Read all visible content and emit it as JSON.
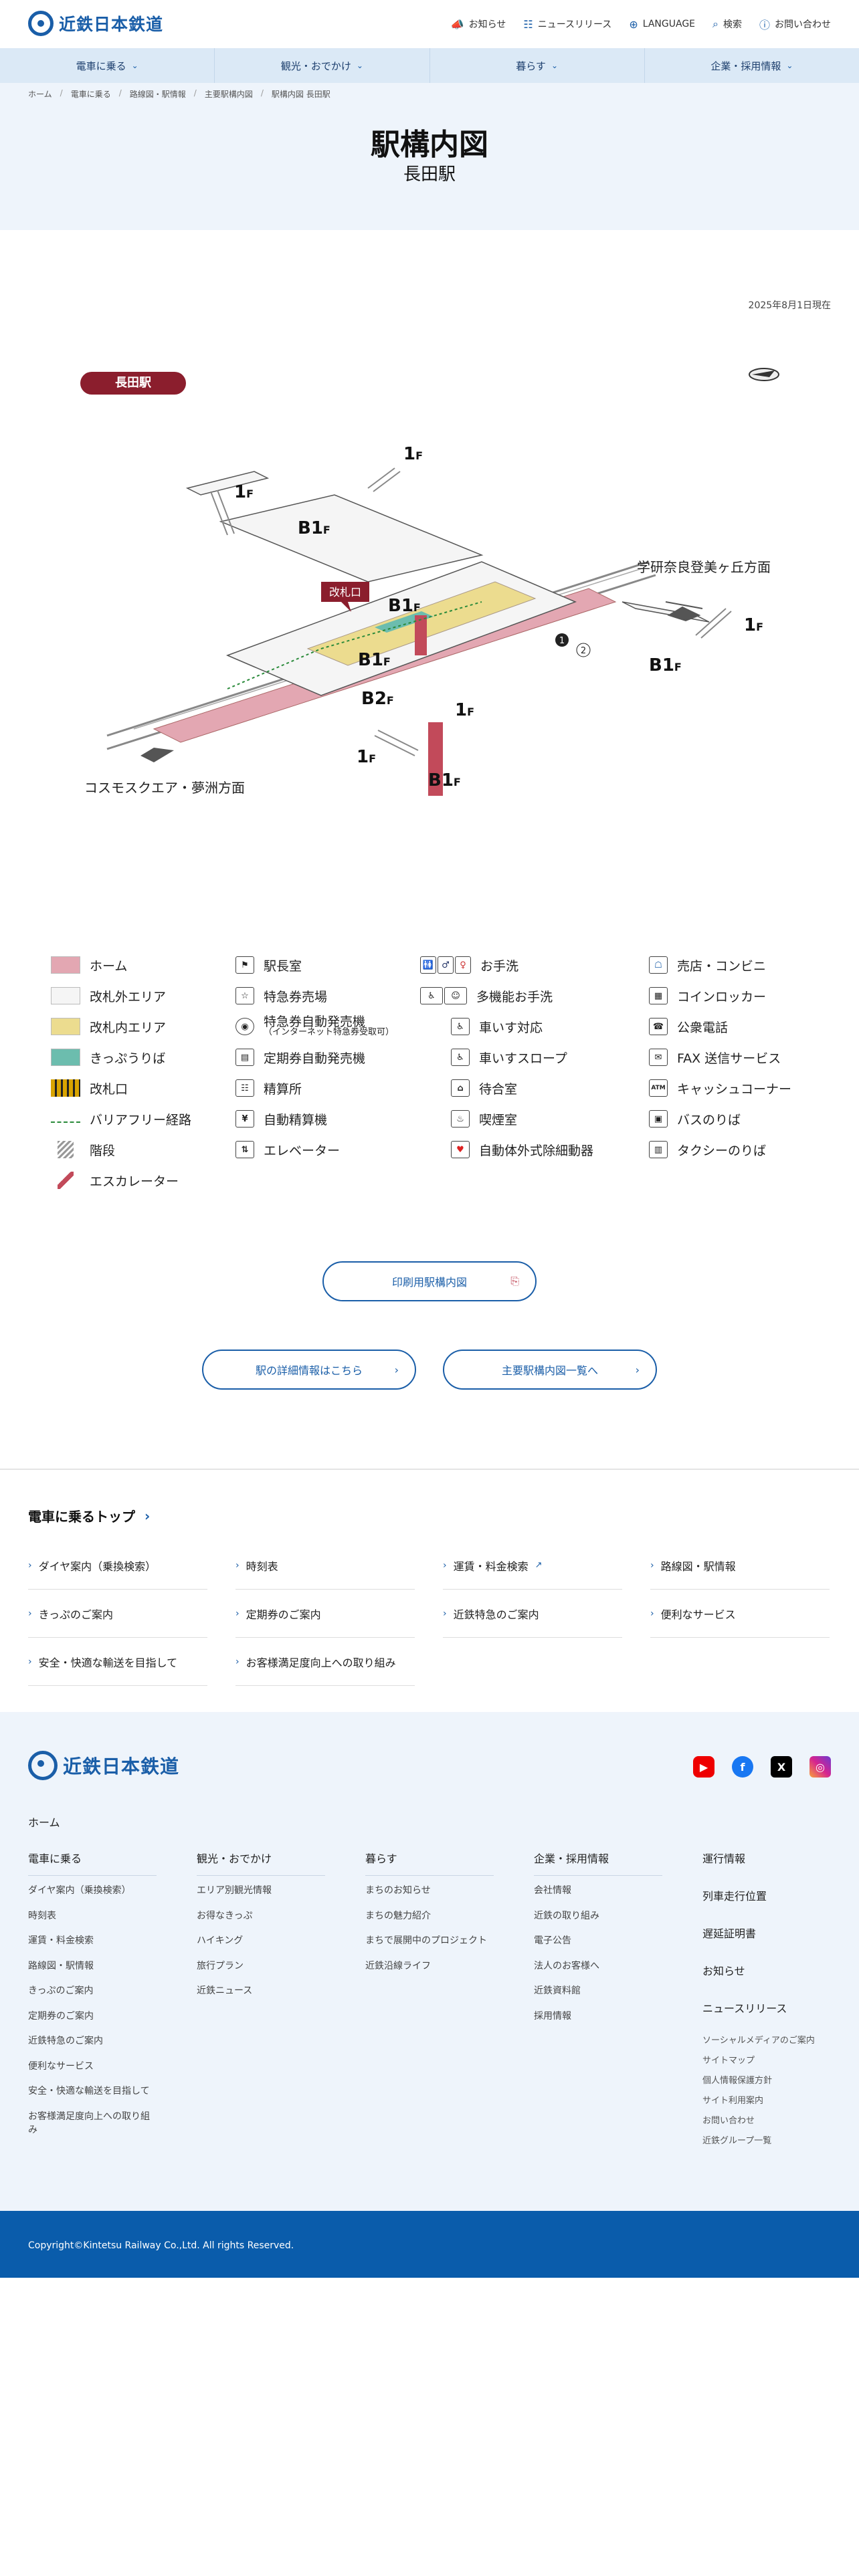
{
  "header": {
    "logo": "近鉄日本鉄道",
    "util_nav": [
      {
        "label": "お知らせ",
        "icon": "megaphone-icon"
      },
      {
        "label": "ニュースリリース",
        "icon": "document-icon"
      },
      {
        "label": "LANGUAGE",
        "icon": "globe-icon"
      },
      {
        "label": "検索",
        "icon": "search-icon"
      },
      {
        "label": "お問い合わせ",
        "icon": "question-icon"
      }
    ],
    "gnav": [
      "電車に乗る",
      "観光・おでかけ",
      "暮らす",
      "企業・採用情報"
    ]
  },
  "breadcrumb": [
    "ホーム",
    "電車に乗る",
    "路線図・駅情報",
    "主要駅構内図",
    "駅構内図 長田駅"
  ],
  "page": {
    "title": "駅構内図",
    "subtitle": "長田駅",
    "updated": "2025年8月1日現在"
  },
  "map": {
    "station_name": "長田駅",
    "direction_east": "学研奈良登美ヶ丘方面",
    "direction_west": "コスモスクエア・夢洲方面",
    "gate_label": "改札口",
    "floors": [
      "1F",
      "1F",
      "B1F",
      "B1F",
      "B1F",
      "B2F",
      "1F",
      "1F",
      "B1F",
      "1F",
      "B1F"
    ],
    "platforms": [
      "1",
      "2"
    ]
  },
  "legend": {
    "col1": [
      {
        "label": "ホーム",
        "color": "#e3a7b2"
      },
      {
        "label": "改札外エリア",
        "color": "#f5f5f5"
      },
      {
        "label": "改札内エリア",
        "color": "#ecdc8f"
      },
      {
        "label": "きっぷうりば",
        "color": "#6cbdae"
      },
      {
        "label": "改札口"
      },
      {
        "label": "バリアフリー経路"
      },
      {
        "label": "階段"
      },
      {
        "label": "エスカレーター"
      }
    ],
    "col2": [
      {
        "label": "駅長室",
        "sub": ""
      },
      {
        "label": "特急券売場",
        "sub": ""
      },
      {
        "label": "特急券自動発売機",
        "sub": "（インターネット特急券受取可）"
      },
      {
        "label": "定期券自動発売機",
        "sub": ""
      },
      {
        "label": "精算所",
        "sub": ""
      },
      {
        "label": "自動精算機",
        "sub": ""
      },
      {
        "label": "エレベーター",
        "sub": ""
      }
    ],
    "col3": [
      {
        "label": "お手洗"
      },
      {
        "label": "多機能お手洗"
      },
      {
        "label": "車いす対応"
      },
      {
        "label": "車いすスロープ"
      },
      {
        "label": "待合室"
      },
      {
        "label": "喫煙室"
      },
      {
        "label": "自動体外式除細動器"
      }
    ],
    "col4": [
      {
        "label": "売店・コンビニ"
      },
      {
        "label": "コインロッカー"
      },
      {
        "label": "公衆電話"
      },
      {
        "label": "FAX 送信サービス"
      },
      {
        "label": "キャッシュコーナー"
      },
      {
        "label": "バスのりば"
      },
      {
        "label": "タクシーのりば"
      }
    ]
  },
  "buttons": {
    "print": "印刷用駅構内図",
    "detail": "駅の詳細情報はこちら",
    "list": "主要駅構内図一覧へ"
  },
  "related": {
    "title": "電車に乗るトップ",
    "links": [
      "ダイヤ案内（乗換検索）",
      "時刻表",
      "運賃・料金検索",
      "路線図・駅情報",
      "きっぷのご案内",
      "定期券のご案内",
      "近鉄特急のご案内",
      "便利なサービス",
      "安全・快適な輸送を目指して",
      "お客様満足度向上への取り組み"
    ]
  },
  "footer": {
    "logo": "近鉄日本鉄道",
    "home": "ホーム",
    "columns": [
      {
        "title": "電車に乗る",
        "items": [
          "ダイヤ案内（乗換検索）",
          "時刻表",
          "運賃・料金検索",
          "路線図・駅情報",
          "きっぷのご案内",
          "定期券のご案内",
          "近鉄特急のご案内",
          "便利なサービス",
          "安全・快適な輸送を目指して",
          "お客様満足度向上への取り組み"
        ]
      },
      {
        "title": "観光・おでかけ",
        "items": [
          "エリア別観光情報",
          "お得なきっぷ",
          "ハイキング",
          "旅行プラン",
          "近鉄ニュース"
        ]
      },
      {
        "title": "暮らす",
        "items": [
          "まちのお知らせ",
          "まちの魅力紹介",
          "まちで展開中のプロジェクト",
          "近鉄沿線ライフ"
        ]
      },
      {
        "title": "企業・採用情報",
        "items": [
          "会社情報",
          "近鉄の取り組み",
          "電子公告",
          "法人のお客様へ",
          "近鉄資料館",
          "採用情報"
        ]
      }
    ],
    "main_links": [
      "運行情報",
      "列車走行位置",
      "遅延証明書",
      "お知らせ",
      "ニュースリリース"
    ],
    "small_links": [
      "ソーシャルメディアのご案内",
      "サイトマップ",
      "個人情報保護方針",
      "サイト利用案内",
      "お問い合わせ",
      "近鉄グループ一覧"
    ],
    "copyright": "Copyright©Kintetsu Railway Co.,Ltd. All rights Reserved."
  },
  "colors": {
    "brand": "#1a5ea8",
    "hero_bg": "#eef4fb",
    "station_pill": "#8b1e2d",
    "copyright_bg": "#0a5cab"
  }
}
